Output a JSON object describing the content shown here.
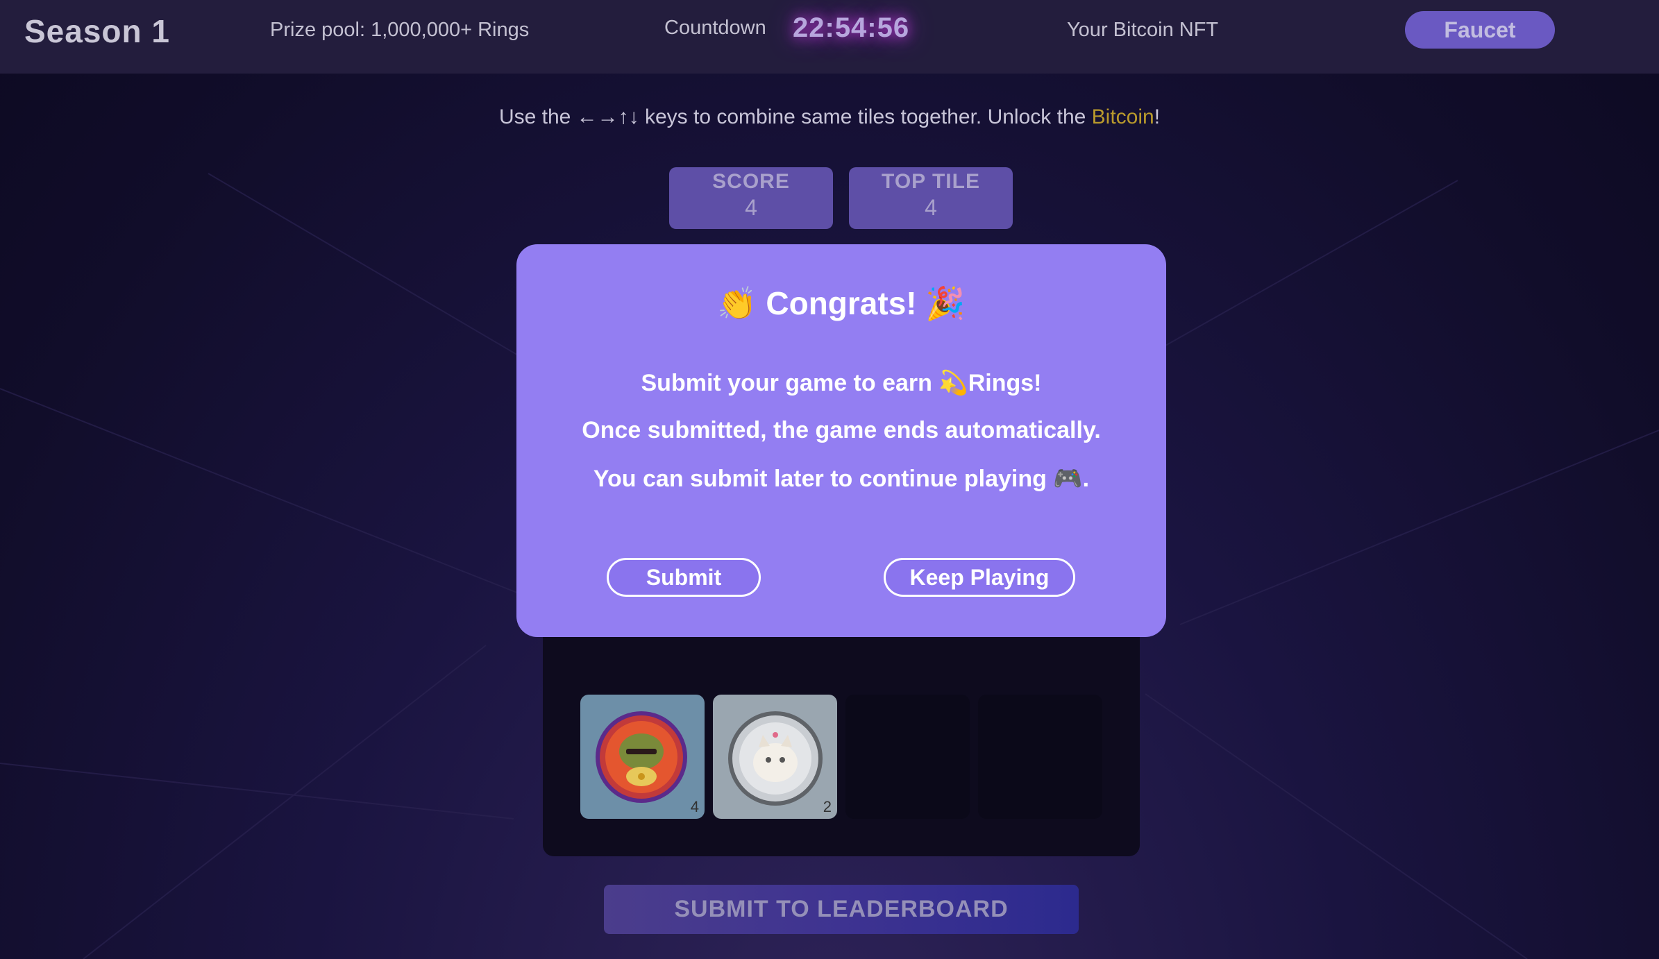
{
  "header": {
    "season": "Season 1",
    "prize_pool": "Prize pool: 1,000,000+ Rings",
    "countdown_label": "Countdown",
    "countdown_time": "22:54:56",
    "nft_link": "Your Bitcoin NFT",
    "faucet_label": "Faucet"
  },
  "instructions": {
    "prefix": "Use the ←→↑↓ keys to combine same tiles together. Unlock the ",
    "highlight": "Bitcoin",
    "suffix": "!"
  },
  "stats": {
    "score_label": "SCORE",
    "score_value": "4",
    "top_tile_label": "TOP TILE",
    "top_tile_value": "4"
  },
  "board": {
    "tiles": [
      {
        "value": "4",
        "icon": "pepe-coin-icon"
      },
      {
        "value": "2",
        "icon": "cat-coin-icon"
      }
    ]
  },
  "submit_leaderboard_label": "SUBMIT TO LEADERBOARD",
  "modal": {
    "title_emoji_left": "👏",
    "title": "Congrats!",
    "title_emoji_right": "🎉",
    "line1_prefix": "Submit your game to earn ",
    "line1_emoji": "💫",
    "line1_suffix": "Rings!",
    "line2": "Once submitted, the game ends automatically.",
    "line3_prefix": "You can submit later to continue playing ",
    "line3_emoji": "🎮",
    "line3_suffix": ".",
    "submit_label": "Submit",
    "keep_playing_label": "Keep Playing"
  },
  "colors": {
    "modal_bg": "#937ef2",
    "header_bg": "#231d3d",
    "accent_button": "#6a59c2",
    "highlight_text": "#b99a2c"
  }
}
